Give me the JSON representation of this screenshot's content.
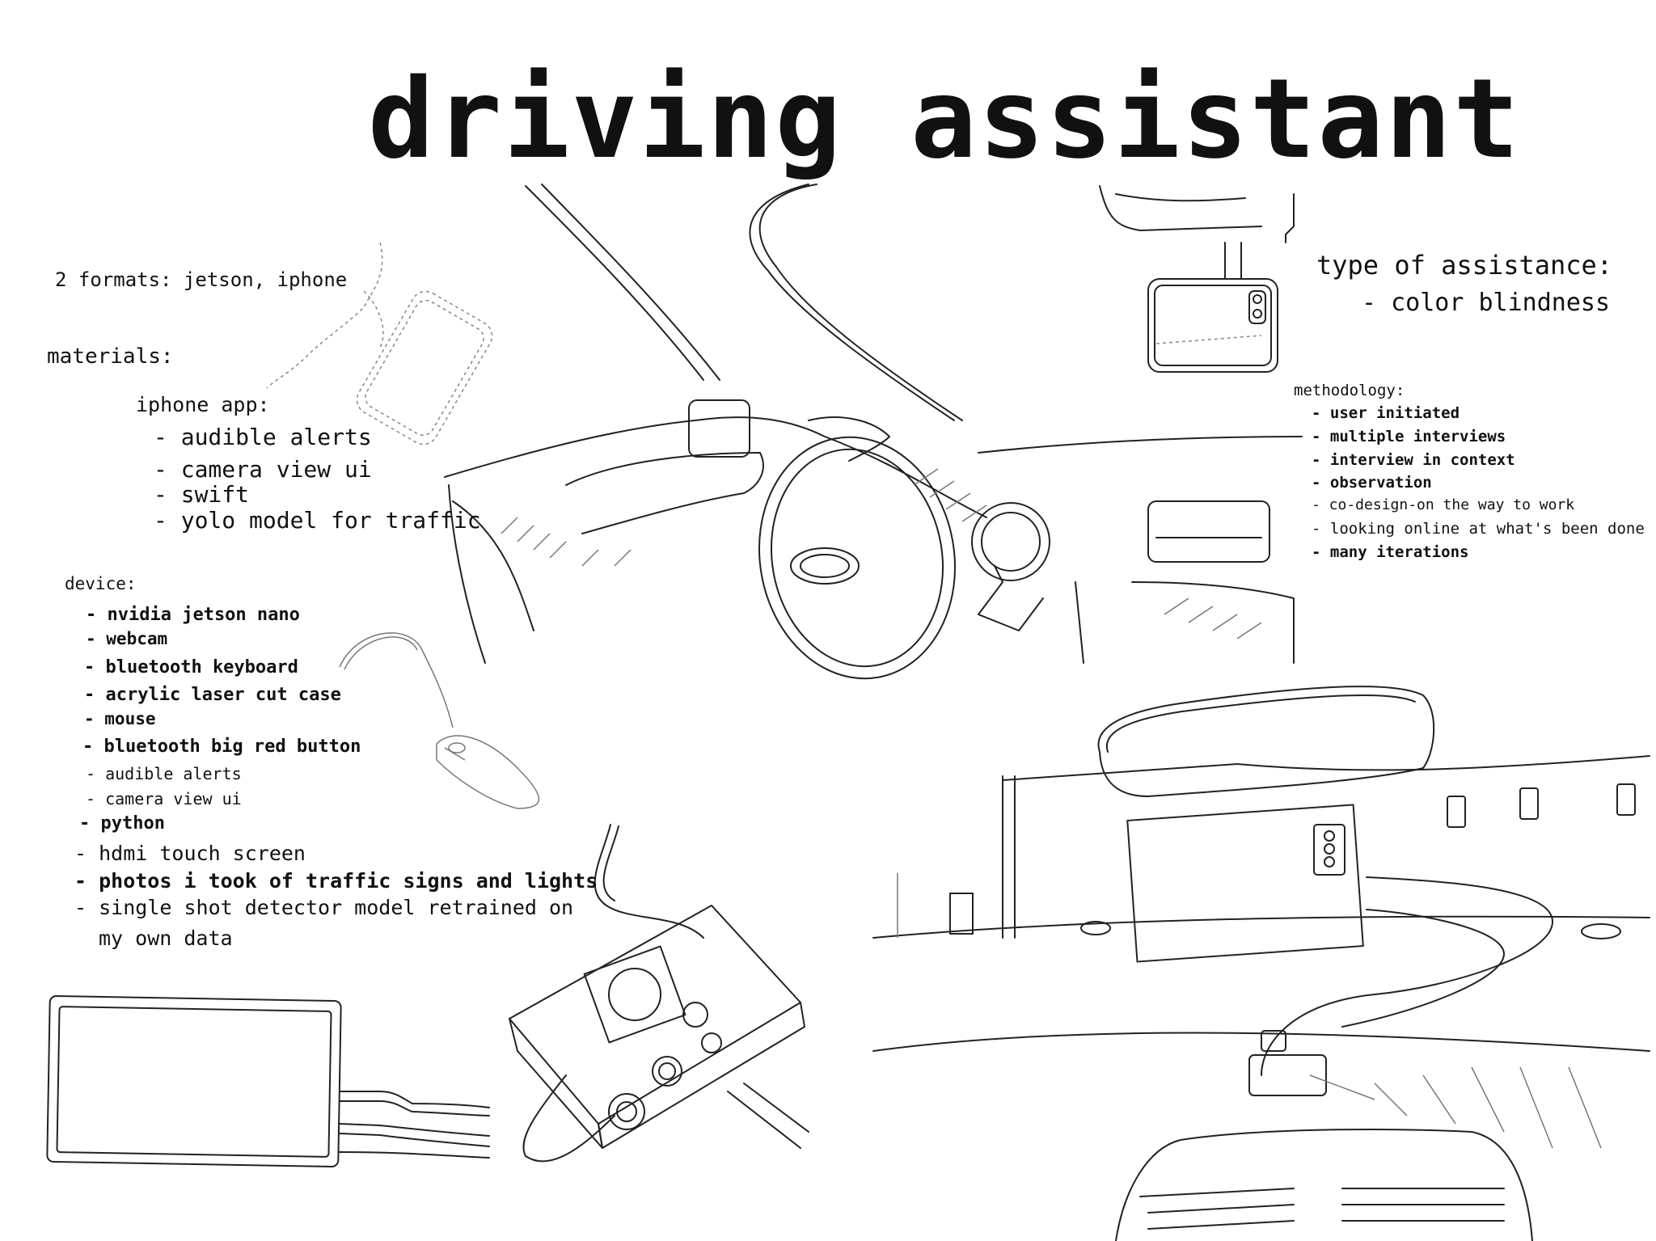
{
  "title": "driving assistant",
  "formats": "2 formats: jetson, iphone",
  "materials": {
    "heading": "materials:",
    "iphone_app": {
      "heading": "iphone app:",
      "items": [
        "- audible alerts",
        "- camera view ui",
        "- swift",
        "- yolo model for traffic"
      ]
    }
  },
  "device": {
    "heading": "device:",
    "items": [
      "- nvidia jetson nano",
      "- webcam",
      "- bluetooth keyboard",
      "- acrylic laser cut case",
      "- mouse",
      "- bluetooth big red button",
      "- audible alerts",
      "- camera view ui",
      "- python",
      "- hdmi touch screen",
      "- photos i took of traffic signs and lights",
      "- single shot detector model retrained on",
      "my own data"
    ]
  },
  "assistance": {
    "heading": "type of assistance:",
    "items": [
      "- color blindness"
    ]
  },
  "methodology": {
    "heading": "methodology:",
    "items": [
      "- user initiated",
      "- multiple interviews",
      "- interview in context",
      "- observation",
      "- co-design-on the way to work",
      "- looking online at what's been done",
      "- many iterations"
    ]
  },
  "illustrations": [
    "hand-holding-phone-sketch",
    "dash-mounted-phone-sketch",
    "driver-steering-wheel-sketch",
    "computer-mouse-sketch",
    "touch-screen-sketch",
    "jetson-nano-case-sketch",
    "windshield-mounted-device-sketch"
  ]
}
